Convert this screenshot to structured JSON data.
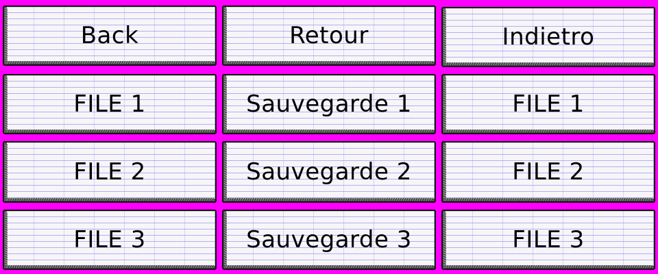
{
  "colors": {
    "background": "#ff00ff",
    "paper": "#f7f5f8",
    "rule_line": "#7878eb",
    "text": "#000000"
  },
  "columns": [
    {
      "language": "en",
      "back_label": "Back",
      "files": [
        "FILE 1",
        "FILE 2",
        "FILE 3"
      ]
    },
    {
      "language": "fr",
      "back_label": "Retour",
      "files": [
        "Sauvegarde 1",
        "Sauvegarde 2",
        "Sauvegarde 3"
      ]
    },
    {
      "language": "it",
      "back_label": "Indietro",
      "files": [
        "FILE 1",
        "FILE 2",
        "FILE 3"
      ]
    }
  ]
}
